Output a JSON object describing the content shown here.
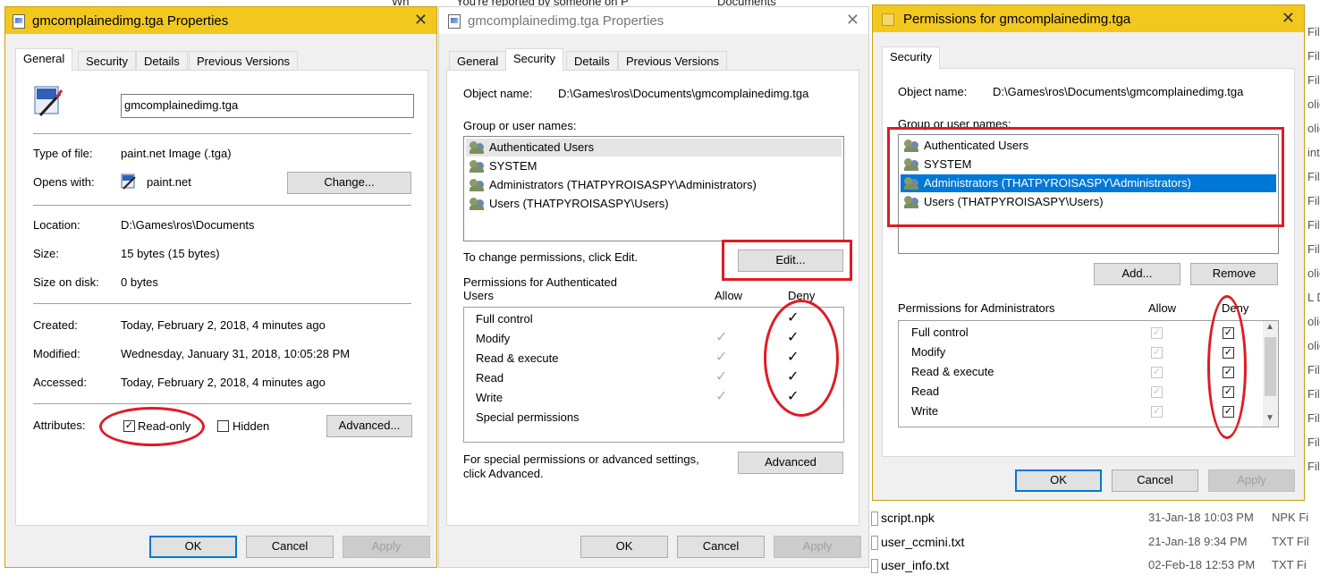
{
  "background": {
    "top_fragment_1": "Wh",
    "top_fragment_2": "You're reported by someone on P",
    "top_fragment_3": "Documents",
    "right_edge": [
      "Fil",
      "Fil",
      "Fil",
      "olic",
      "olic",
      "int.n",
      "Fil",
      "Fil",
      "Fil",
      "Fil",
      "olic",
      "L Do",
      "olic",
      "olic",
      "Fil",
      "Fil",
      "Fil",
      "Fil",
      "Fil"
    ],
    "files": [
      {
        "name": "script.npk",
        "date": "31-Jan-18 10:03 PM",
        "type": "NPK Fi"
      },
      {
        "name": "user_ccmini.txt",
        "date": "21-Jan-18 9:34 PM",
        "type": "TXT Fil"
      },
      {
        "name": "user_info.txt",
        "date": "02-Feb-18 12:53 PM",
        "type": "TXT Fi"
      }
    ]
  },
  "general_dialog": {
    "title": "gmcomplainedimg.tga Properties",
    "tabs": [
      "General",
      "Security",
      "Details",
      "Previous Versions"
    ],
    "filename": "gmcomplainedimg.tga",
    "type_label": "Type of file:",
    "type_value": "paint.net Image (.tga)",
    "opens_label": "Opens with:",
    "opens_value": "paint.net",
    "change_button": "Change...",
    "location_label": "Location:",
    "location_value": "D:\\Games\\ros\\Documents",
    "size_label": "Size:",
    "size_value": "15 bytes (15 bytes)",
    "size_disk_label": "Size on disk:",
    "size_disk_value": "0 bytes",
    "created_label": "Created:",
    "created_value": "Today, February 2, 2018, 4 minutes ago",
    "modified_label": "Modified:",
    "modified_value": "Wednesday, January 31, 2018, 10:05:28 PM",
    "accessed_label": "Accessed:",
    "accessed_value": "Today, February 2, 2018, 4 minutes ago",
    "attributes_label": "Attributes:",
    "readonly_label": "Read-only",
    "readonly_checked": true,
    "hidden_label": "Hidden",
    "hidden_checked": false,
    "advanced_button": "Advanced...",
    "ok": "OK",
    "cancel": "Cancel",
    "apply": "Apply"
  },
  "security_dialog": {
    "title": "gmcomplainedimg.tga Properties",
    "tabs": [
      "General",
      "Security",
      "Details",
      "Previous Versions"
    ],
    "object_label": "Object name:",
    "object_value": "D:\\Games\\ros\\Documents\\gmcomplainedimg.tga",
    "group_label": "Group or user names:",
    "users": [
      "Authenticated Users",
      "SYSTEM",
      "Administrators (THATPYROISASPY\\Administrators)",
      "Users (THATPYROISASPY\\Users)"
    ],
    "change_hint": "To change permissions, click Edit.",
    "edit_button": "Edit...",
    "perm_label_1": "Permissions for Authenticated",
    "perm_label_2": "Users",
    "allow_header": "Allow",
    "deny_header": "Deny",
    "permissions": [
      "Full control",
      "Modify",
      "Read & execute",
      "Read",
      "Write",
      "Special permissions"
    ],
    "allow_ticks": [
      false,
      true,
      true,
      true,
      true,
      false
    ],
    "deny_ticks": [
      true,
      true,
      true,
      true,
      true,
      false
    ],
    "special_hint_1": "For special permissions or advanced settings,",
    "special_hint_2": "click Advanced.",
    "advanced_button": "Advanced",
    "ok": "OK",
    "cancel": "Cancel",
    "apply": "Apply"
  },
  "permissions_dialog": {
    "title": "Permissions for gmcomplainedimg.tga",
    "tab": "Security",
    "object_label": "Object name:",
    "object_value": "D:\\Games\\ros\\Documents\\gmcomplainedimg.tga",
    "group_label": "Group or user names:",
    "users": [
      "Authenticated Users",
      "SYSTEM",
      "Administrators (THATPYROISASPY\\Administrators)",
      "Users (THATPYROISASPY\\Users)"
    ],
    "selected_user_index": 2,
    "add_button": "Add...",
    "remove_button": "Remove",
    "perm_label": "Permissions for Administrators",
    "allow_header": "Allow",
    "deny_header": "Deny",
    "permissions": [
      "Full control",
      "Modify",
      "Read & execute",
      "Read",
      "Write"
    ],
    "allow_checked": [
      true,
      true,
      true,
      true,
      true
    ],
    "deny_checked": [
      true,
      true,
      true,
      true,
      true
    ],
    "ok": "OK",
    "cancel": "Cancel",
    "apply": "Apply"
  },
  "colors": {
    "title_bar_active": "#f2c81e",
    "title_bar_inactive": "#ffffff",
    "selection_blue": "#0078d7",
    "annotation_red": "#e01b24"
  }
}
